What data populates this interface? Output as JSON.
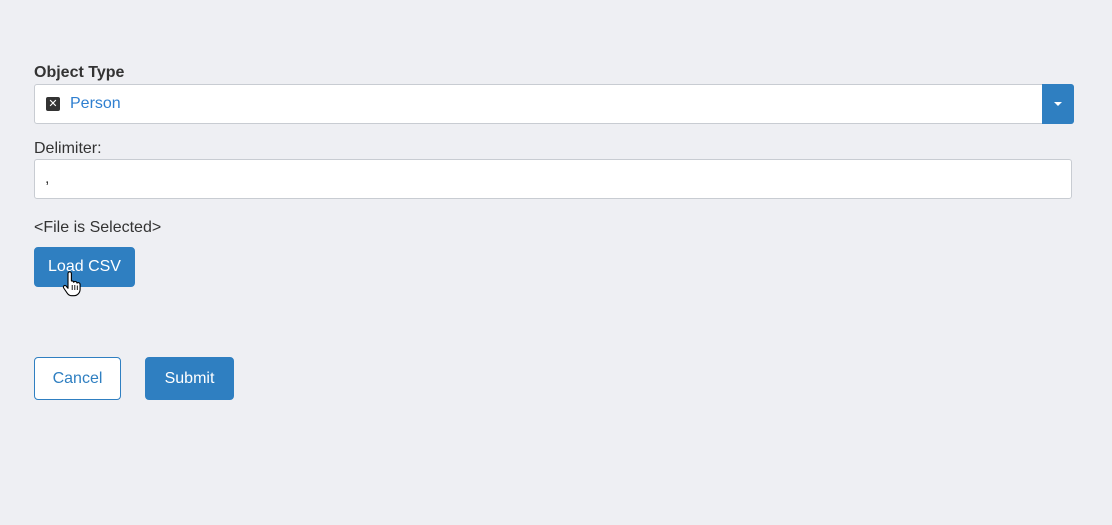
{
  "object_type": {
    "label": "Object Type",
    "selected_value": "Person",
    "clear_symbol": "✕"
  },
  "delimiter": {
    "label": "Delimiter:",
    "value": ","
  },
  "file": {
    "status_text": "<File is Selected>",
    "load_label": "Load CSV"
  },
  "actions": {
    "cancel_label": "Cancel",
    "submit_label": "Submit"
  },
  "colors": {
    "background": "#eeeff3",
    "accent": "#2f7fc1",
    "selected_text": "#2f7fd0"
  },
  "icons": {
    "clear": "clear-icon",
    "dropdown": "chevron-down-icon",
    "cursor": "hand-pointer-icon"
  }
}
